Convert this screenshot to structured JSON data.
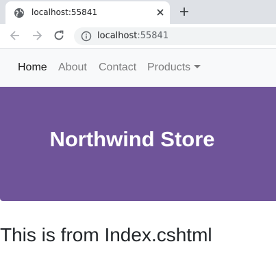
{
  "browser": {
    "tab_title": "localhost:55841",
    "url_host": "localhost",
    "url_port": ":55841"
  },
  "navbar": {
    "links": [
      {
        "label": "Home",
        "active": true
      },
      {
        "label": "About",
        "active": false
      },
      {
        "label": "Contact",
        "active": false
      },
      {
        "label": "Products",
        "active": false,
        "dropdown": true
      }
    ]
  },
  "jumbotron": {
    "title": "Northwind Store",
    "background": "#6f5499"
  },
  "main": {
    "heading": "This is from Index.cshtml"
  }
}
